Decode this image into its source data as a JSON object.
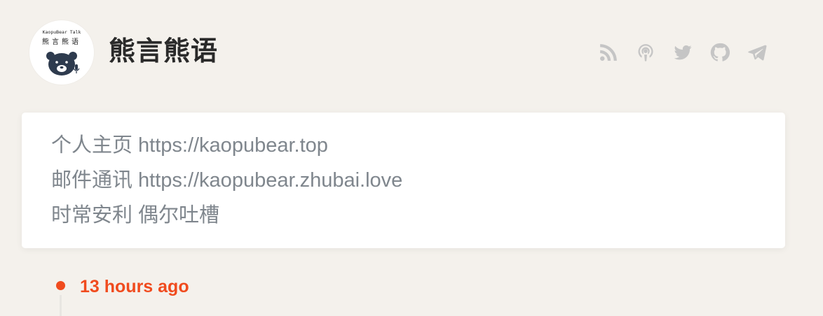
{
  "header": {
    "avatar": {
      "brand_text": "KaopuBear Talk",
      "brand_cn": "熊言熊语",
      "icon": "bear-microphone-logo"
    },
    "title": "熊言熊语",
    "social_icons": [
      {
        "icon": "rss-icon"
      },
      {
        "icon": "podcast-icon"
      },
      {
        "icon": "twitter-icon"
      },
      {
        "icon": "github-icon"
      },
      {
        "icon": "telegram-icon"
      }
    ]
  },
  "bio": {
    "lines": [
      {
        "label": "个人主页",
        "value": "https://kaopubear.top"
      },
      {
        "label": "邮件通讯",
        "value": "https://kaopubear.zhubai.love"
      },
      {
        "label": "时常安利",
        "value": "偶尔吐槽"
      }
    ]
  },
  "timeline": {
    "first_entry_time": "13 hours ago"
  },
  "colors": {
    "background": "#f4f1ec",
    "accent": "#f04b1e",
    "text_muted": "#7f868d",
    "icon": "#c5c5c5"
  }
}
